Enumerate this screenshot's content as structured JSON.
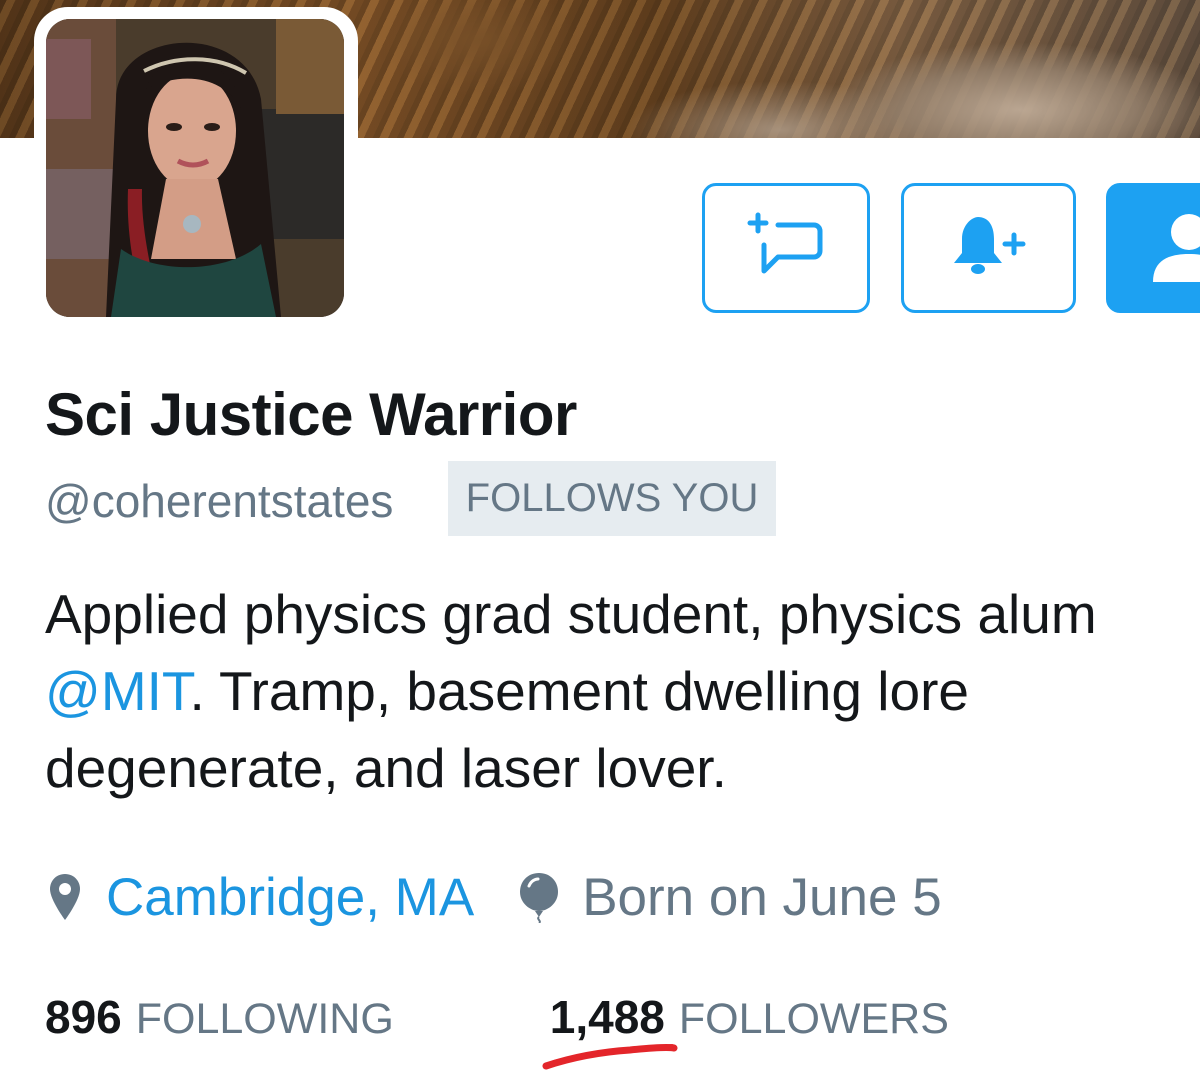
{
  "profile": {
    "display_name": "Sci Justice Warrior",
    "handle": "@coherentstates",
    "follows_you_badge": "FOLLOWS YOU",
    "bio": {
      "part1": "Applied physics grad student, physics alum ",
      "mention": "@MIT",
      "part2": ". Tramp, basement dwelling lore degenerate, and laser lover."
    },
    "location": "Cambridge, MA",
    "birthday": "Born on June 5",
    "stats": {
      "following_count": "896",
      "following_label": "FOLLOWING",
      "followers_count": "1,488",
      "followers_label": "FOLLOWERS"
    }
  },
  "icons": {
    "message": "message-plus-icon",
    "notifications": "bell-plus-icon",
    "follow": "person-icon",
    "location": "location-pin-icon",
    "birthday": "balloon-icon"
  },
  "colors": {
    "accent": "#1da1f2",
    "link": "#1b95e0",
    "secondary_text": "#657786",
    "primary_text": "#14171a",
    "badge_bg": "#e6ecf0",
    "annotation_red": "#e3262b"
  }
}
